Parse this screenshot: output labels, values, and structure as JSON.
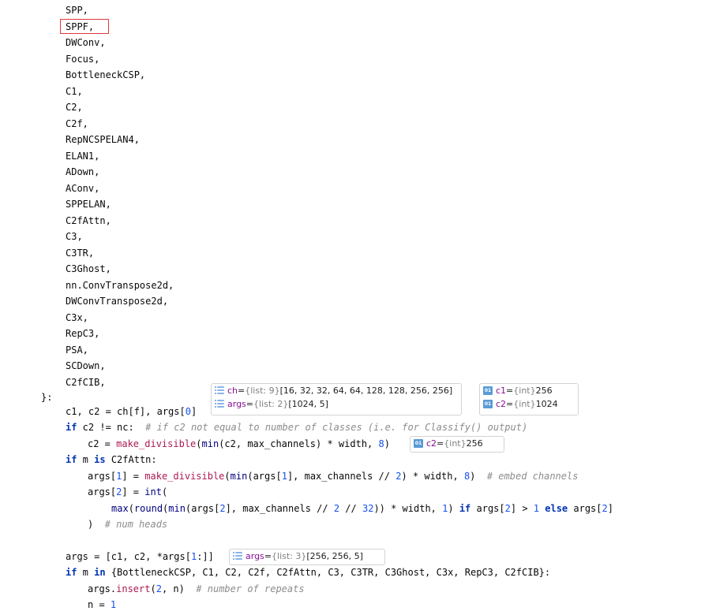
{
  "modules": [
    "SPP,",
    "SPPF,",
    "DWConv,",
    "Focus,",
    "BottleneckCSP,",
    "C1,",
    "C2,",
    "C2f,",
    "RepNCSPELAN4,",
    "ELAN1,",
    "ADown,",
    "AConv,",
    "SPPELAN,",
    "C2fAttn,",
    "C3,",
    "C3TR,",
    "C3Ghost,",
    "nn.ConvTranspose2d,",
    "DWConvTranspose2d,",
    "C3x,",
    "RepC3,",
    "PSA,",
    "SCDown,",
    "C2fCIB,"
  ],
  "close_brace": "}:",
  "code": {
    "l1": "c1, c2 = ch[f], args[",
    "l1_idx": "0",
    "l1_end": "]",
    "l2_if": "if",
    "l2_cond": " c2 != nc:  ",
    "l2_comment": "# if c2 not equal to number of classes (i.e. for Classify() output)",
    "l3_a": "c2 = ",
    "l3_fn": "make_divisible",
    "l3_b": "(",
    "l3_min": "min",
    "l3_c": "(c2, max_channels) * width, ",
    "l3_num": "8",
    "l3_d": ")",
    "l4_if": "if",
    "l4_m": " m ",
    "l4_is": "is",
    "l4_cls": " C2fAttn:",
    "l5_a": "args[",
    "l5_i1": "1",
    "l5_b": "] = ",
    "l5_fn": "make_divisible",
    "l5_c": "(",
    "l5_min": "min",
    "l5_d": "(args[",
    "l5_i2": "1",
    "l5_e": "], max_channels // ",
    "l5_n2": "2",
    "l5_f": ") * width, ",
    "l5_n8": "8",
    "l5_g": ")  ",
    "l5_comment": "# embed channels",
    "l6_a": "args[",
    "l6_i": "2",
    "l6_b": "] = ",
    "l6_int": "int",
    "l6_c": "(",
    "l7_max": "max",
    "l7_a": "(",
    "l7_round": "round",
    "l7_b": "(",
    "l7_min": "min",
    "l7_c": "(args[",
    "l7_i1": "2",
    "l7_d": "], max_channels // ",
    "l7_n2": "2",
    "l7_e": " // ",
    "l7_n32": "32",
    "l7_f": ")) * width, ",
    "l7_n1": "1",
    "l7_g": ") ",
    "l7_if": "if",
    "l7_h": " args[",
    "l7_i2": "2",
    "l7_i": "] > ",
    "l7_n1b": "1",
    "l7_sp": " ",
    "l7_else": "else",
    "l7_j": " args[",
    "l7_i3": "2",
    "l7_k": "]",
    "l8_a": ")  ",
    "l8_comment": "# num heads",
    "l9_a": "args = [c1, c2, *args[",
    "l9_i": "1",
    "l9_b": ":]]",
    "l10_if": "if",
    "l10_m": " m ",
    "l10_in": "in",
    "l10_set": " {BottleneckCSP, C1, C2, C2f, C2fAttn, C3, C3TR, C3Ghost, C3x, RepC3, C2fCIB}:",
    "l11_a": "args.",
    "l11_fn": "insert",
    "l11_b": "(",
    "l11_n2": "2",
    "l11_c": ", n)  ",
    "l11_comment": "# number of repeats",
    "l12_a": "n = ",
    "l12_n": "1"
  },
  "hints": {
    "ch": {
      "name": "ch",
      "eq": " = ",
      "type": "{list: 9}",
      "value": " [16, 32, 32, 64, 64, 128, 128, 256, 256]",
      "icon": "list-icon"
    },
    "args1": {
      "name": "args",
      "eq": " = ",
      "type": "{list: 2}",
      "value": " [1024, 5]",
      "icon": "list-icon"
    },
    "c1": {
      "name": "c1",
      "eq": " = ",
      "type": "{int}",
      "value": " 256",
      "badge": "01",
      "icon": "int-icon"
    },
    "c2a": {
      "name": "c2",
      "eq": " = ",
      "type": "{int}",
      "value": " 1024",
      "badge": "01",
      "icon": "int-icon"
    },
    "c2b": {
      "name": "c2",
      "eq": " = ",
      "type": "{int}",
      "value": " 256",
      "badge": "01",
      "icon": "int-icon"
    },
    "args2": {
      "name": "args",
      "eq": " = ",
      "type": "{list: 3}",
      "value": " [256, 256, 5]",
      "icon": "list-icon"
    }
  },
  "colors": {
    "keyword": "#0033b3",
    "function": "#ad1a51",
    "number": "#1750eb",
    "comment": "#8c8c8c",
    "highlight_box": "#e2383f"
  }
}
